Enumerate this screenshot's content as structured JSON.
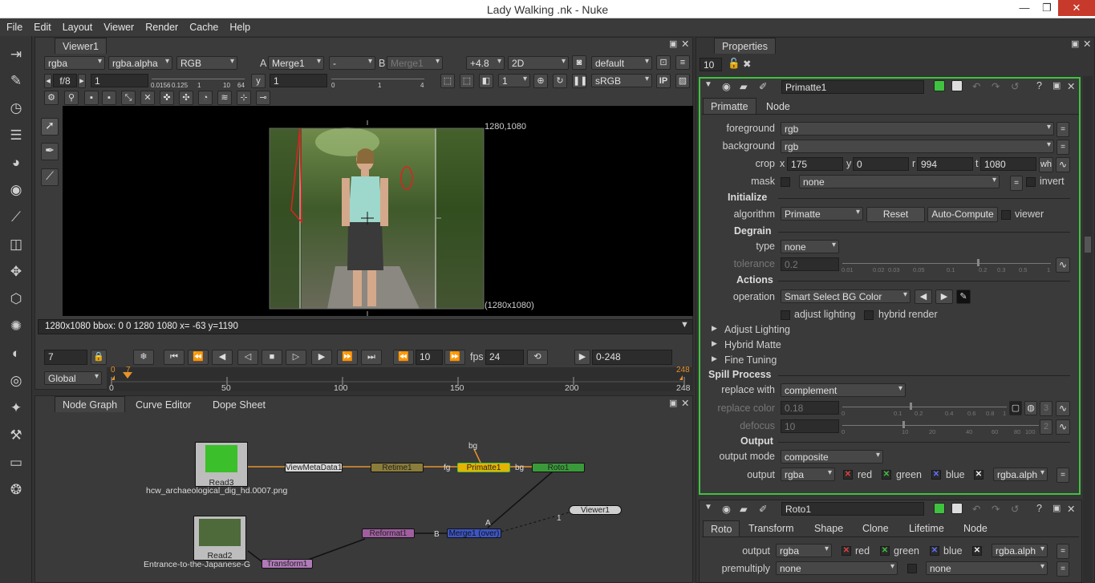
{
  "window": {
    "title": "Lady Walking .nk - Nuke",
    "minimize": "—",
    "maximize": "❐",
    "close": "✕"
  },
  "menu": [
    "File",
    "Edit",
    "Layout",
    "Viewer",
    "Render",
    "Cache",
    "Help"
  ],
  "viewer": {
    "tab": "Viewer1",
    "channels": "rgba",
    "alpha": "rgba.alpha",
    "display": "RGB",
    "a_label": "A",
    "a_input": "Merge1",
    "op": "-",
    "b_label": "B",
    "b_input": "Merge1",
    "gain": "+4.8",
    "mode": "2D",
    "lut_default": "default",
    "fstop": "f/8",
    "gain_value": "1",
    "gamma_label": "y",
    "gamma_value": "1",
    "gain_ticks": [
      "0.0156",
      "0.125",
      "1",
      "10",
      "64"
    ],
    "gamma_ticks": [
      "0",
      "1",
      "4"
    ],
    "proxy": "1",
    "colorspace": "sRGB",
    "ip": "IP",
    "format_top": "1280,1080",
    "format_bottom": "(1280x1080)",
    "info": "1280x1080 bbox: 0 0 1280 1080  x= -63 y=1190"
  },
  "timeline": {
    "frame": "7",
    "increment": "10",
    "fps_label": "fps",
    "fps": "24",
    "range": "0-248",
    "scope": "Global",
    "ticks": [
      "0",
      "50",
      "100",
      "150",
      "200",
      "248"
    ],
    "marker_start": "0",
    "marker_cur": "7",
    "marker_end": "248"
  },
  "nodegraph": {
    "tabs": [
      "Node Graph",
      "Curve Editor",
      "Dope Sheet"
    ],
    "nodes": {
      "read3": "Read3",
      "read3_file": "hcw_archaeological_dig_hd.0007.png",
      "read2": "Read2",
      "read2_file": "Entrance-to-the-Japanese-G",
      "viewmeta": "ViewMetaData1",
      "retime": "Retime1",
      "primatte": "Primatte1",
      "roto": "Roto1",
      "viewer": "Viewer1",
      "reformat": "Reformat1",
      "merge": "Merge1 (over)",
      "transform": "Transform1"
    },
    "edge_labels": {
      "bg_top": "bg",
      "fg": "fg",
      "bg": "bg",
      "a": "A",
      "b": "B",
      "one": "1"
    }
  },
  "properties": {
    "title": "Properties",
    "max_panels": "10",
    "primatte": {
      "name": "Primatte1",
      "tabs": [
        "Primatte",
        "Node"
      ],
      "foreground_label": "foreground",
      "foreground": "rgb",
      "background_label": "background",
      "background": "rgb",
      "crop_label": "crop",
      "crop_x_label": "x",
      "crop_x": "175",
      "crop_y_label": "y",
      "crop_y": "0",
      "crop_r_label": "r",
      "crop_r": "994",
      "crop_t_label": "t",
      "crop_t": "1080",
      "crop_wh": "wh",
      "mask_label": "mask",
      "mask": "none",
      "invert": "invert",
      "initialize": "Initialize",
      "algorithm_label": "algorithm",
      "algorithm": "Primatte",
      "reset": "Reset",
      "auto_compute": "Auto-Compute",
      "viewer": "viewer",
      "degrain": "Degrain",
      "type_label": "type",
      "type": "none",
      "tolerance_label": "tolerance",
      "tolerance": "0.2",
      "tol_ticks": [
        "0.01",
        "0.02",
        "0.03",
        "0.05",
        "0.1",
        "0.2",
        "0.3",
        "0.5",
        "1"
      ],
      "actions": "Actions",
      "operation_label": "operation",
      "operation": "Smart Select BG Color",
      "adjust_lighting_chk": "adjust lighting",
      "hybrid_render": "hybrid render",
      "adjust_lighting": "Adjust Lighting",
      "hybrid_matte": "Hybrid Matte",
      "fine_tuning": "Fine Tuning",
      "spill": "Spill Process",
      "replace_with_label": "replace with",
      "replace_with": "complement",
      "replace_color_label": "replace color",
      "replace_color": "0.18",
      "rc_ticks": [
        "0",
        "0.1",
        "0.2",
        "0.4",
        "0.6",
        "0.8",
        "1"
      ],
      "rc_extra": "3",
      "defocus_label": "defocus",
      "defocus": "10",
      "df_ticks": [
        "0",
        "10",
        "20",
        "40",
        "60",
        "80",
        "100"
      ],
      "df_extra": "2",
      "output": "Output",
      "output_mode_label": "output mode",
      "output_mode": "composite",
      "output_label": "output",
      "output_ch": "rgba",
      "red": "red",
      "green": "green",
      "blue": "blue",
      "alpha_ch": "rgba.alph"
    },
    "roto": {
      "name": "Roto1",
      "tabs": [
        "Roto",
        "Transform",
        "Shape",
        "Clone",
        "Lifetime",
        "Node"
      ],
      "output_label": "output",
      "output_ch": "rgba",
      "red": "red",
      "green": "green",
      "blue": "blue",
      "alpha_ch": "rgba.alph",
      "premultiply_label": "premultiply",
      "premultiply": "none",
      "premult2": "none"
    }
  },
  "colors": {
    "accent_green": "#3fc23f",
    "node_retime": "#8a7c3a",
    "node_primatte": "#e5b400",
    "node_roto": "#3a9a3a",
    "node_merge": "#3d55c4",
    "node_reformat": "#a05ea0",
    "node_transform": "#b07ab8"
  }
}
